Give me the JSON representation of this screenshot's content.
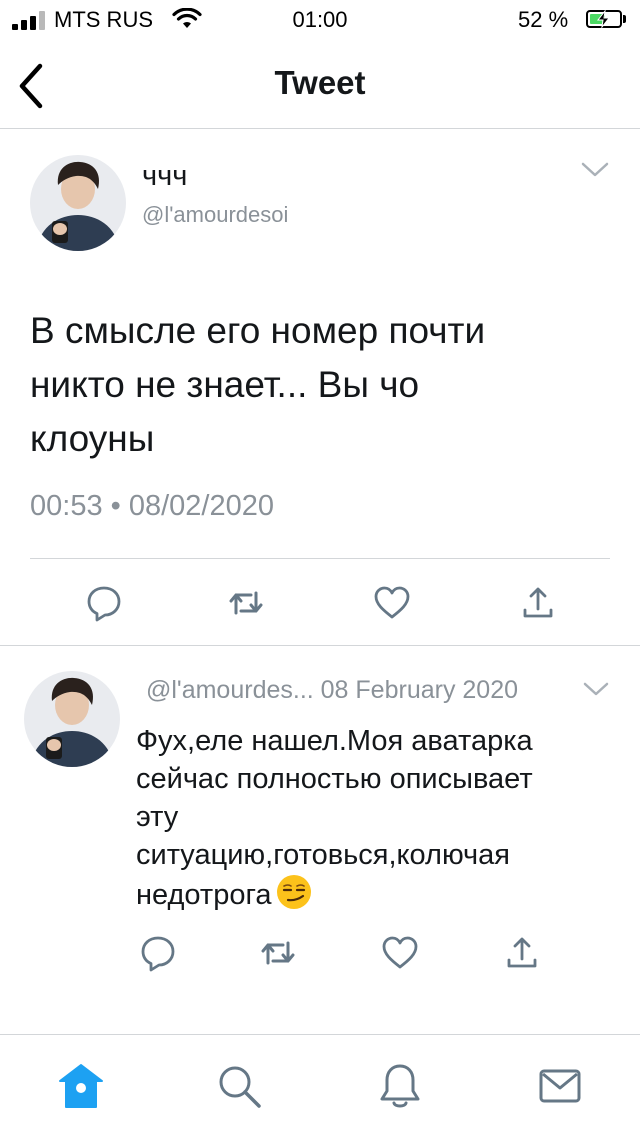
{
  "status_bar": {
    "carrier": "MTS RUS",
    "time": "01:00",
    "battery_percent": "52 %",
    "battery_level": 0.52,
    "signal_bars": 3
  },
  "nav": {
    "title": "Tweet"
  },
  "tweet": {
    "name": "ччч",
    "handle": "@l'amourdesoi",
    "text_lines": [
      "В смысле его номер почти",
      "никто не знает... Вы чо",
      "клоуны"
    ],
    "timestamp": "00:53 • 08/02/2020"
  },
  "reply": {
    "meta": "@l'amourdes... 08 February 2020",
    "text_lines": [
      "Фух,еле нашел.Моя аватарка",
      "сейчас полностью описывает",
      "эту",
      "ситуацию,готовься,колючая",
      "недотрога"
    ],
    "emoji": "smirking-face"
  },
  "icons": {
    "reply": "reply-icon",
    "retweet": "retweet-icon",
    "like": "heart-icon",
    "share": "share-icon",
    "home": "home-icon",
    "search": "search-icon",
    "notifications": "bell-icon",
    "messages": "mail-icon"
  },
  "colors": {
    "accent": "#1da1f2",
    "icon_gray": "#657786",
    "muted_text": "#8a9198",
    "divider": "#d3d6d9"
  }
}
